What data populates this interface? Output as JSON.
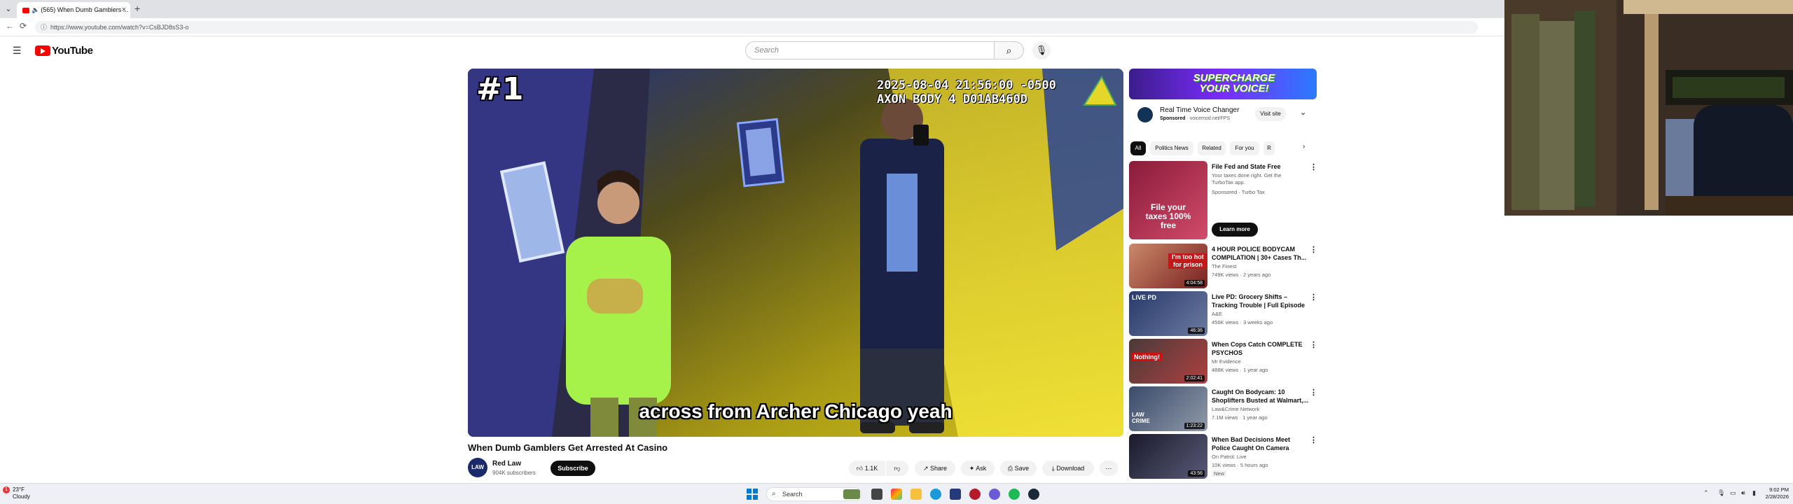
{
  "browser": {
    "tab_title": "(565) When Dumb Gamblers ...",
    "address": "https://www.youtube.com/watch?v=CsBJD8sS3-o"
  },
  "youtube": {
    "logo_text": "YouTube",
    "search_placeholder": "Search"
  },
  "video": {
    "rank_overlay": "#1",
    "bodycam_stamp": "2025-08-04 21:56:00 -0500\nAXON BODY 4 D01AB460D",
    "caption": "across from Archer Chicago yeah",
    "title": "When Dumb Gamblers Get Arrested At Casino",
    "channel": "Red Law",
    "channel_avatar_text": "LAW",
    "subscribers": "904K subscribers",
    "subscribe_label": "Subscribe",
    "likes": "1.1K",
    "share_label": "Share",
    "ask_label": "Ask",
    "save_label": "Save",
    "download_label": "Download"
  },
  "ad": {
    "banner_text": "SUPERCHARGE YOUR VOICE!",
    "name": "Real Time Voice Changer",
    "sponsored": "Sponsored",
    "domain": "voicemod.net/FPS",
    "visit_label": "Visit site"
  },
  "chips": [
    "All",
    "Politics News",
    "Related",
    "For you",
    "R"
  ],
  "recommendations": [
    {
      "title": "File Fed and State Free",
      "channel": "Your taxes done right. Get the TurboTax app.",
      "meta": "Sponsored · Turbo Tax",
      "duration": "",
      "thumb_text": "File your taxes 100% free",
      "cta": "Learn more"
    },
    {
      "title": "4 HOUR POLICE BODYCAM COMPILATION | 30+ Cases Th...",
      "channel": "The Finest",
      "meta": "749K views · 2 years ago",
      "duration": "4:04:58",
      "thumb_text": "I'm too hot for prison"
    },
    {
      "title": "Live PD: Grocery Shifts – Tracking Trouble | Full Episode",
      "channel": "A&E",
      "meta": "456K views · 3 weeks ago",
      "duration": "46:36",
      "thumb_text": "LIVE PD"
    },
    {
      "title": "When Cops Catch COMPLETE PSYCHOS",
      "channel": "Mr Evidence",
      "meta": "488K views · 1 year ago",
      "duration": "2:02:41",
      "thumb_text": "Nothing!"
    },
    {
      "title": "Caught On Bodycam: 10 Shoplifters Busted at Walmart,...",
      "channel": "Law&Crime Network",
      "meta": "7.1M views · 1 year ago",
      "duration": "1:23:22",
      "thumb_text": "LAW CRIME"
    },
    {
      "title": "When Bad Decisions Meet Police Caught On Camera",
      "channel": "On Patrol: Live",
      "meta": "10K views · 5 hours ago",
      "duration": "43:56",
      "thumb_text": "",
      "badge": "New"
    }
  ],
  "taskbar": {
    "temperature": "23°F",
    "weather": "Cloudy",
    "weather_badge": "1",
    "search_label": "Search",
    "time": "9:02 PM",
    "date": "2/28/2026"
  },
  "colors": {
    "accent": "#ff0000",
    "chip_active": "#0f0f0f"
  }
}
